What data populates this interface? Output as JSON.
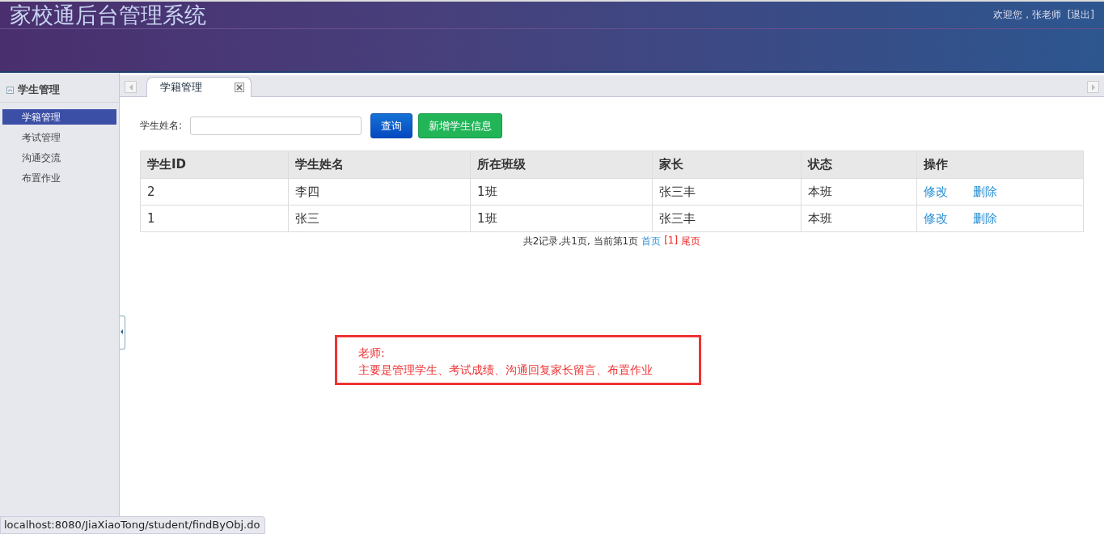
{
  "header": {
    "title": "家校通后台管理系统",
    "greeting": "欢迎您，张老师",
    "logout": "[退出]"
  },
  "sidebar": {
    "group": {
      "title": "学生管理",
      "expanded": true
    },
    "items": [
      {
        "label": "学籍管理",
        "selected": true
      },
      {
        "label": "考试管理",
        "selected": false
      },
      {
        "label": "沟通交流",
        "selected": false
      },
      {
        "label": "布置作业",
        "selected": false
      }
    ]
  },
  "tabs": [
    {
      "label": "学籍管理",
      "selected": true
    }
  ],
  "search": {
    "label": "学生姓名:",
    "query_button": "查询",
    "add_button": "新增学生信息"
  },
  "table": {
    "columns": [
      "学生ID",
      "学生姓名",
      "所在班级",
      "家长",
      "状态",
      "操作"
    ],
    "rows": [
      {
        "cells": [
          "2",
          "李四",
          "1班",
          "张三丰",
          "本班"
        ],
        "actions": [
          "修改",
          "删除"
        ]
      },
      {
        "cells": [
          "1",
          "张三",
          "1班",
          "张三丰",
          "本班"
        ],
        "actions": [
          "修改",
          "删除"
        ]
      }
    ]
  },
  "pagination": {
    "summary": "共2记录,共1页, 当前第1页",
    "first": "首页",
    "current": "[1]",
    "last": "尾页"
  },
  "note": {
    "lines": [
      "老师:",
      "主要是管理学生、考试成绩、沟通回复家长留言、布置作业"
    ]
  },
  "status_bar": {
    "url": "localhost:8080/JiaXiaoTong/student/findByObj.do"
  }
}
